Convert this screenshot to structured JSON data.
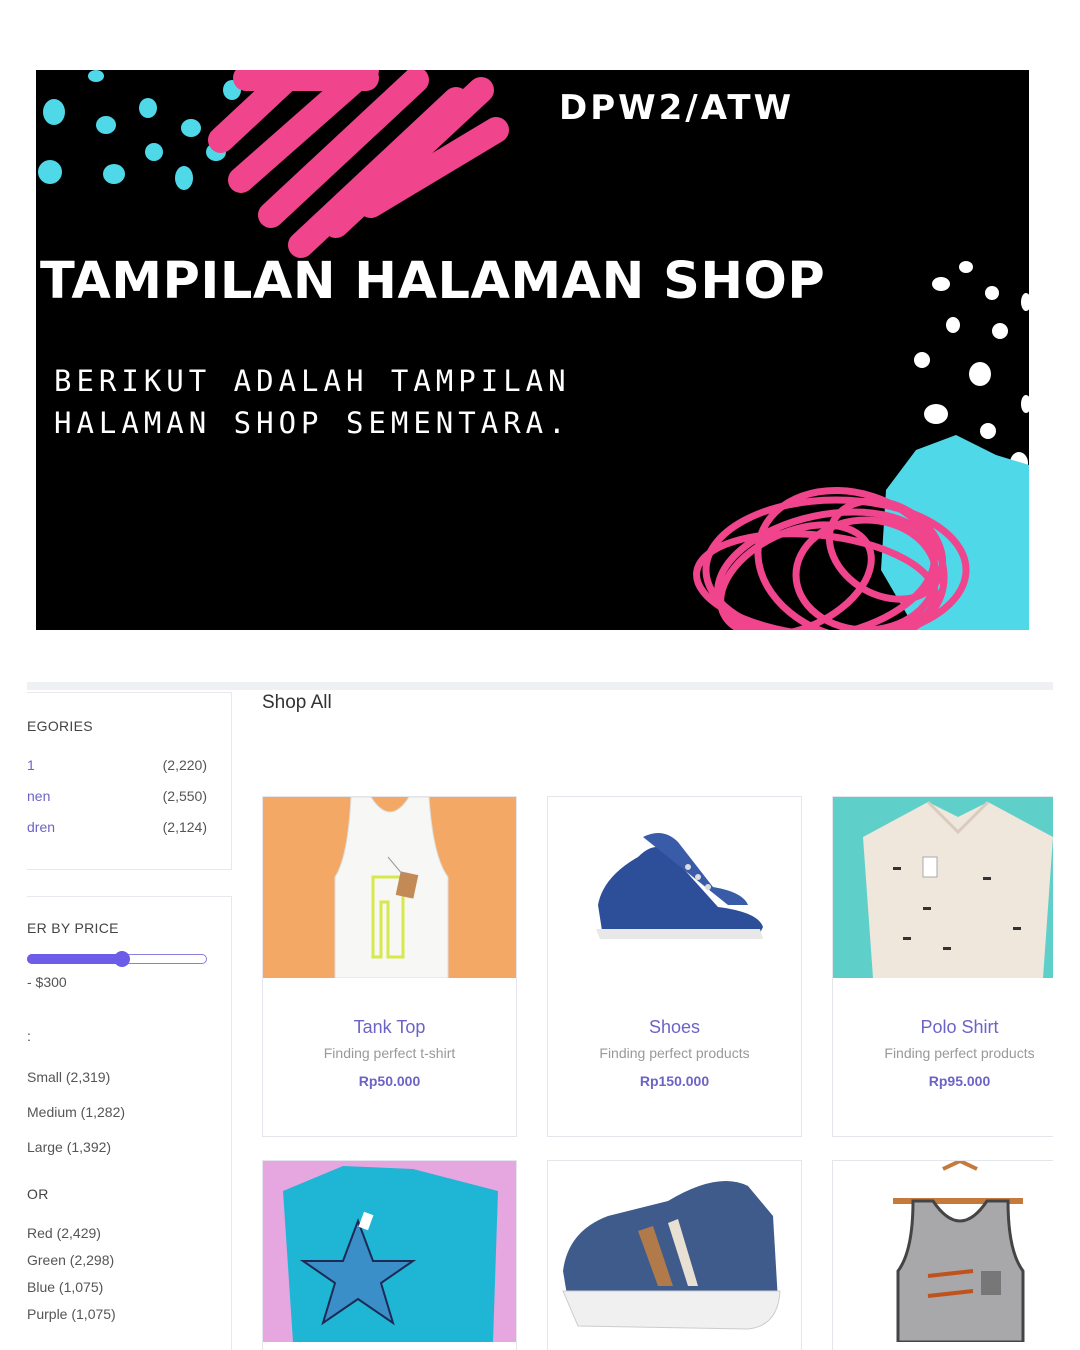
{
  "banner": {
    "tag": "DPW2/ATW",
    "title": "TAMPILAN HALAMAN SHOP",
    "subtitle_line1": "BERIKUT ADALAH TAMPILAN",
    "subtitle_line2": "HALAMAN SHOP SEMENTARA.",
    "colors": {
      "background": "#000000",
      "pink": "#f0448c",
      "cyan": "#4fd8e8",
      "white": "#ffffff"
    }
  },
  "shop": {
    "heading": "Shop All",
    "categories_heading": "EGORIES",
    "categories": [
      {
        "name": "1",
        "count": "(2,220)"
      },
      {
        "name": "nen",
        "count": "(2,550)"
      },
      {
        "name": "dren",
        "count": "(2,124)"
      }
    ],
    "price_filter_heading": "ER BY PRICE",
    "price_range_text": "- $300",
    "price_slider_level": 0.53,
    "size_heading": ":",
    "sizes": [
      "Small (2,319)",
      "Medium (1,282)",
      "Large (1,392)"
    ],
    "color_heading": "OR",
    "colors_list": [
      "Red (2,429)",
      "Green (2,298)",
      "Blue (1,075)",
      "Purple (1,075)"
    ],
    "accent_color": "#6c5ce7",
    "products": [
      {
        "name": "Tank Top",
        "desc": "Finding perfect t-shirt",
        "price": "Rp50.000",
        "icon": "tank-top-image"
      },
      {
        "name": "Shoes",
        "desc": "Finding perfect products",
        "price": "Rp150.000",
        "icon": "shoes-image"
      },
      {
        "name": "Polo Shirt",
        "desc": "Finding perfect products",
        "price": "Rp95.000",
        "icon": "polo-shirt-image"
      },
      {
        "name": "",
        "desc": "",
        "price": "",
        "icon": "tshirt-image"
      },
      {
        "name": "",
        "desc": "",
        "price": "",
        "icon": "sneaker-image"
      },
      {
        "name": "",
        "desc": "",
        "price": "",
        "icon": "singlet-image"
      }
    ]
  }
}
